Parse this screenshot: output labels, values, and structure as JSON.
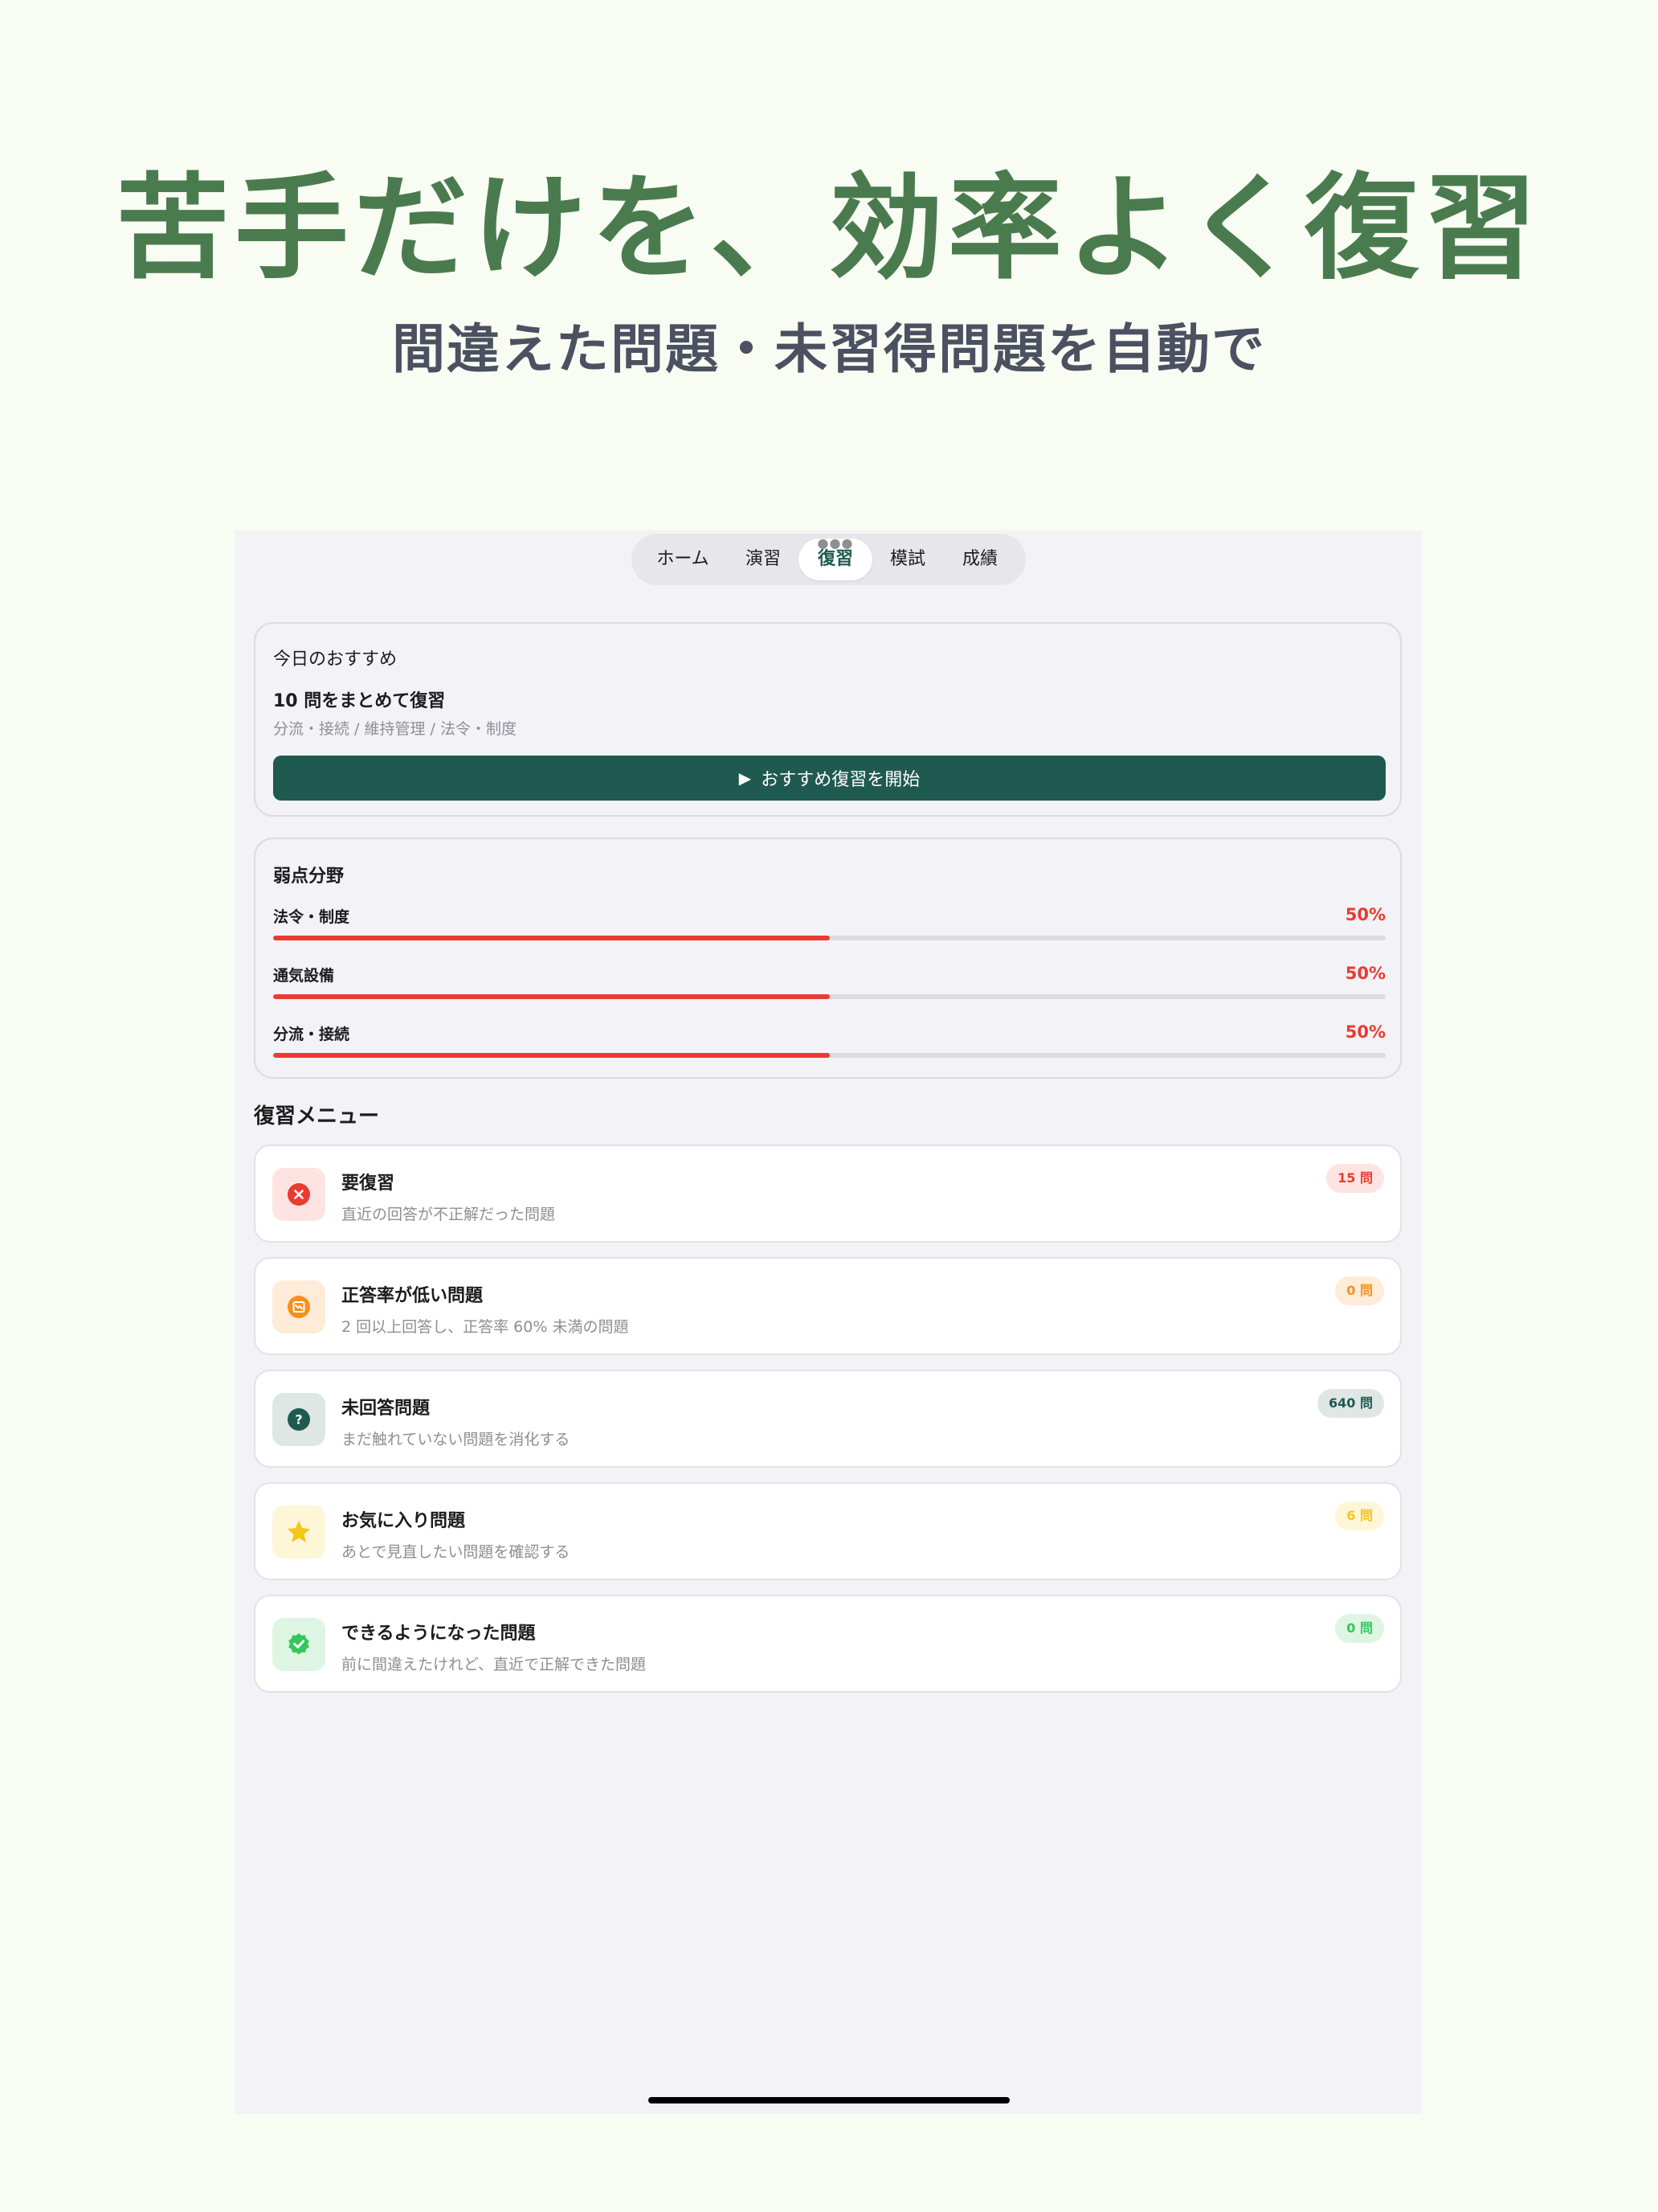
{
  "hero": {
    "title": "苦手だけを、効率よく復習",
    "subtitle": "間違えた問題・未習得問題を自動で"
  },
  "tabs": [
    {
      "label": "ホーム",
      "active": false
    },
    {
      "label": "演習",
      "active": false
    },
    {
      "label": "復習",
      "active": true
    },
    {
      "label": "模試",
      "active": false
    },
    {
      "label": "成績",
      "active": false
    }
  ],
  "recommend": {
    "title": "今日のおすすめ",
    "headline": "10 問をまとめて復習",
    "categories": "分流・接続 / 維持管理 / 法令・制度",
    "button_label": "おすすめ復習を開始"
  },
  "weak": {
    "title": "弱点分野",
    "items": [
      {
        "name": "法令・制度",
        "percent": "50%",
        "value": 0.5
      },
      {
        "name": "通気設備",
        "percent": "50%",
        "value": 0.5
      },
      {
        "name": "分流・接続",
        "percent": "50%",
        "value": 0.5
      }
    ]
  },
  "menu": {
    "heading": "復習メニュー",
    "items": [
      {
        "title": "要復習",
        "desc": "直近の回答が不正解だった問題",
        "badge": "15 問",
        "icon": "x-circle-icon",
        "color": "#ea3b30"
      },
      {
        "title": "正答率が低い問題",
        "desc": "2 回以上回答し、正答率 60% 未満の問題",
        "badge": "0 問",
        "icon": "chart-down-icon",
        "color": "#f5901e"
      },
      {
        "title": "未回答問題",
        "desc": "まだ触れていない問題を消化する",
        "badge": "640 問",
        "icon": "question-circle-icon",
        "color": "#1f5a50"
      },
      {
        "title": "お気に入り問題",
        "desc": "あとで見直したい問題を確認する",
        "badge": "6 問",
        "icon": "star-icon",
        "color": "#f5c518"
      },
      {
        "title": "できるようになった問題",
        "desc": "前に間違えたけれど、直近で正解できた問題",
        "badge": "0 問",
        "icon": "check-seal-icon",
        "color": "#34c759"
      }
    ]
  }
}
